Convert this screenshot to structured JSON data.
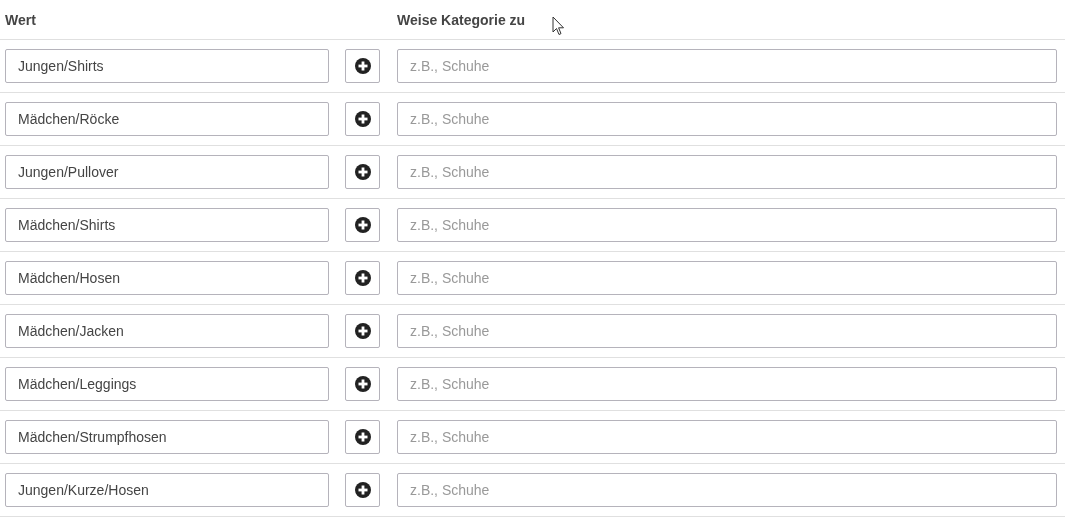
{
  "columns": {
    "value": "Wert",
    "assign": "Weise Kategorie zu"
  },
  "rows": [
    {
      "value": "Jungen/Shirts",
      "placeholder": "z.B., Schuhe"
    },
    {
      "value": "Mädchen/Röcke",
      "placeholder": "z.B., Schuhe"
    },
    {
      "value": "Jungen/Pullover",
      "placeholder": "z.B., Schuhe"
    },
    {
      "value": "Mädchen/Shirts",
      "placeholder": "z.B., Schuhe"
    },
    {
      "value": "Mädchen/Hosen",
      "placeholder": "z.B., Schuhe"
    },
    {
      "value": "Mädchen/Jacken",
      "placeholder": "z.B., Schuhe"
    },
    {
      "value": "Mädchen/Leggings",
      "placeholder": "z.B., Schuhe"
    },
    {
      "value": "Mädchen/Strumpfhosen",
      "placeholder": "z.B., Schuhe"
    },
    {
      "value": "Jungen/Kurze/Hosen",
      "placeholder": "z.B., Schuhe"
    }
  ]
}
